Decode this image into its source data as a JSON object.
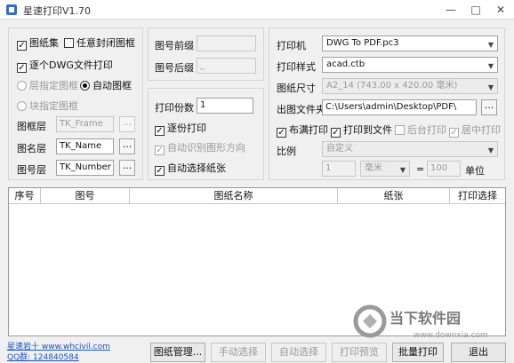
{
  "window": {
    "title": "星速打印V1.70",
    "minimize": "—",
    "maximize": "□",
    "close": "✕"
  },
  "left": {
    "sheet_set": {
      "label": "图纸集",
      "checked": true
    },
    "any_closed_frame": {
      "label": "任意封闭图框",
      "checked": false
    },
    "per_dwg_print": {
      "label": "逐个DWG文件打印",
      "checked": true
    },
    "layer_frame": {
      "label": "层指定图框"
    },
    "auto_frame": {
      "label": "自动图框"
    },
    "block_frame": {
      "label": "块指定图框"
    },
    "frame_layer": {
      "label": "图框层",
      "value": "TK_Frame"
    },
    "name_layer": {
      "label": "图名层",
      "value": "TK_Name"
    },
    "number_layer": {
      "label": "图号层",
      "value": "TK_Number"
    },
    "browse": "..."
  },
  "middle": {
    "prefix": {
      "label": "图号前缀",
      "value": ""
    },
    "suffix": {
      "label": "图号后缀",
      "value": "_"
    },
    "copies": {
      "label": "打印份数",
      "value": "1"
    },
    "collate": {
      "label": "逐份打印",
      "checked": true
    },
    "auto_orient": {
      "label": "自动识别图形方向",
      "checked": true
    },
    "auto_paper": {
      "label": "自动选择纸张",
      "checked": true
    }
  },
  "right": {
    "printer": {
      "label": "打印机",
      "value": "DWG To PDF.pc3"
    },
    "style": {
      "label": "打印样式",
      "value": "acad.ctb"
    },
    "paper": {
      "label": "图纸尺寸",
      "value": "A2_14 (743.00 x 420.00 毫米)"
    },
    "out_folder": {
      "label": "出图文件夹",
      "value": "C:\\Users\\admin\\Desktop\\PDF\\"
    },
    "fit": {
      "label": "布满打印",
      "checked": true
    },
    "to_file": {
      "label": "打印到文件",
      "checked": true
    },
    "background": {
      "label": "后台打印",
      "checked": false
    },
    "center": {
      "label": "居中打印",
      "checked": true
    },
    "scale": {
      "label": "比例",
      "value": "自定义"
    },
    "scale_num": "1",
    "unit_select": "毫米",
    "equals": "=",
    "scale_den": "100",
    "unit_label": "单位",
    "browse": "..."
  },
  "table": {
    "columns": [
      "序号",
      "图号",
      "图纸名称",
      "纸张",
      "打印选择"
    ]
  },
  "footer": {
    "author": "星速岩十 www.whcivil.com",
    "qq": "QQ群: 124840584",
    "buttons": [
      "图纸管理...",
      "手动选择",
      "自动选择",
      "打印预览",
      "批量打印",
      "退出"
    ]
  },
  "watermark": {
    "brand": "当下软件园",
    "url": "www.downxia.com"
  }
}
